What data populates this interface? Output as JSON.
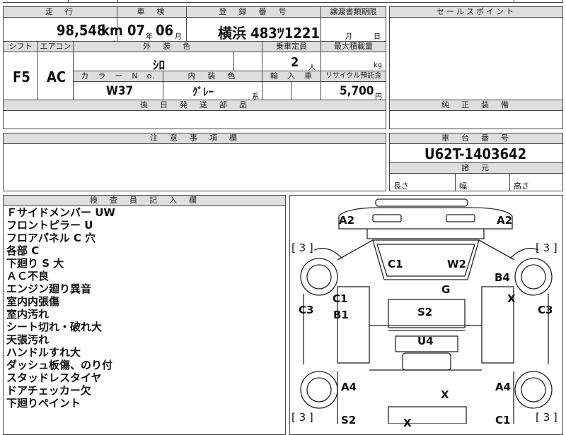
{
  "sheet": {
    "mileage_header": "走　行",
    "mileage_value": "98,548",
    "mileage_unit": "km",
    "inspection_header": "車　検",
    "inspection_year": "07",
    "inspection_year_unit": "年",
    "inspection_month": "06",
    "inspection_month_unit": "月",
    "registration_header": "登　録　番　号",
    "registration_value": "横浜 483ﾂ1221",
    "transfer_header": "譲渡書類期限",
    "transfer_month_unit": "月",
    "transfer_day_unit": "日",
    "selling_points_header": "セールスポイント",
    "shift_header": "シフト",
    "shift_value": "F5",
    "ac_header": "エアコン",
    "ac_value": "AC",
    "exterior_color_header": "外　装　色",
    "exterior_color_value": "ｼﾛ",
    "capacity_header": "乗車定員",
    "capacity_value": "2",
    "capacity_unit": "人",
    "max_load_header": "最大積載量",
    "max_load_unit": "kg",
    "color_no_header": "カ　ラ　ー　N　o.",
    "color_no_value": "W37",
    "interior_color_header": "内　装　色",
    "interior_color_value": "ｸﾞﾚｰ",
    "interior_suffix": "系",
    "import_header": "輸　入　車",
    "recycle_header": "リサイクル預託金",
    "recycle_value": "5,700",
    "recycle_unit": "円",
    "parts_header": "後　日　発　送　部　品",
    "genuine_equipment_header": "純　正　装　備",
    "notes_header": "注　意　事　項　欄",
    "chassis_header": "車　台　番　号",
    "chassis_value": "U62T-1403642",
    "dimensions_header": "諸　元",
    "length_label": "長さ",
    "width_label": "幅",
    "height_label": "高さ",
    "inspector_header": "検　査　員　記　入　欄",
    "inspector_notes": [
      "Ｆサイドメンバー UW",
      "フロントピラー U",
      "フロアパネル C 穴",
      "各部 C",
      "下廻り S 大",
      "ＡＣ不良",
      "エンジン廻り異音",
      "室内内張傷",
      "室内汚れ",
      "シート切れ・破れ大",
      "天張汚れ",
      "ハンドルすれ大",
      "ダッシュ板傷、のり付",
      "スタッドレスタイヤ",
      "ドアチェッカー欠",
      "下廻りペイント"
    ]
  },
  "diagram": {
    "marks": {
      "a2_left": "A2",
      "a2_right": "A2",
      "bracket_tl": "[ 3 ]",
      "bracket_tr": "[ 3 ]",
      "c1_top": "C1",
      "w2": "W2",
      "b4": "B4",
      "g": "G",
      "c1_left": "C1",
      "x_right": "X",
      "c3_left": "C3",
      "c3_right": "C3",
      "b1": "B1",
      "s2_center": "S2",
      "u4": "U4",
      "a4_left": "A4",
      "a4_right": "A4",
      "x_lower": "X",
      "bracket_bl": "[ 3 ]",
      "bracket_br": "[ 3 ]",
      "s2_bottom": "S2",
      "x_bottom": "X",
      "c1_bottom": "C1"
    }
  }
}
